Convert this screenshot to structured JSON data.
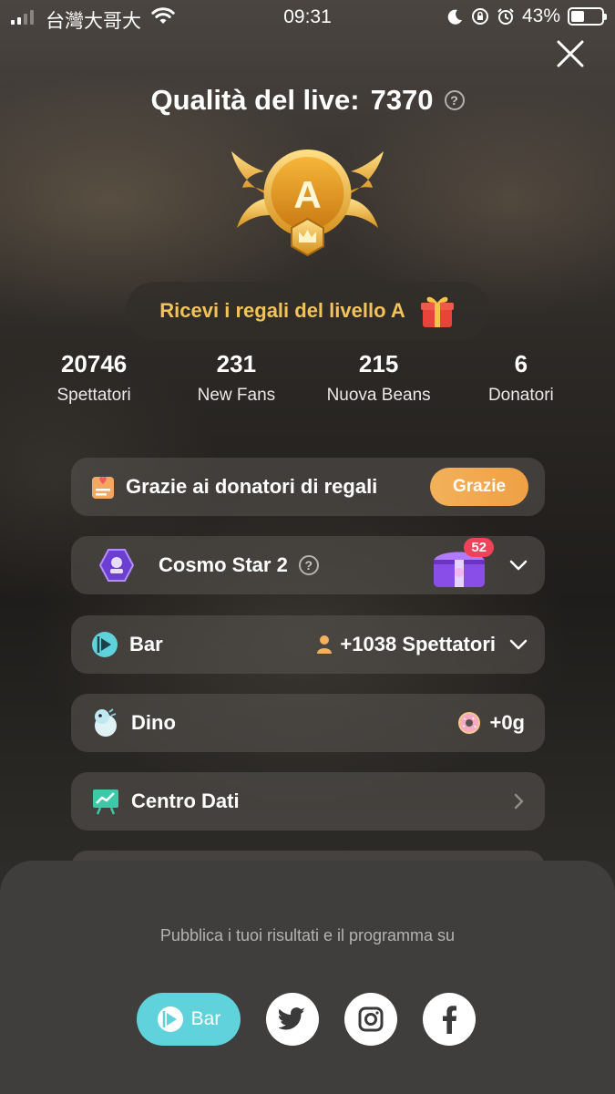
{
  "status_bar": {
    "carrier": "台灣大哥大",
    "time": "09:31",
    "battery": "43%",
    "battery_level": 0.43
  },
  "header": {
    "title_label": "Qualità del live:",
    "score": "7370",
    "help": "?"
  },
  "badge": {
    "grade": "A"
  },
  "reward": {
    "text": "Ricevi i regali del livello A"
  },
  "stats": [
    {
      "value": "20746",
      "label": "Spettatori"
    },
    {
      "value": "231",
      "label": "New Fans"
    },
    {
      "value": "215",
      "label": "Nuova Beans"
    },
    {
      "value": "6",
      "label": "Donatori"
    }
  ],
  "cards": {
    "thanks": {
      "title": "Grazie ai donatori di regali",
      "button": "Grazie"
    },
    "cosmo": {
      "title": "Cosmo Star 2",
      "help": "?",
      "chest_count": "52"
    },
    "bar": {
      "title": "Bar",
      "value": "+1038 Spettatori"
    },
    "dino": {
      "title": "Dino",
      "value": "+0g"
    },
    "data_center": {
      "title": "Centro Dati"
    }
  },
  "share_sheet": {
    "text": "Pubblica i tuoi risultati e il programma su",
    "bar_label": "Bar",
    "icons": [
      "twitter-icon",
      "instagram-icon",
      "facebook-icon"
    ]
  },
  "colors": {
    "accent_gold": "#f2c35a",
    "thanks_button": "#f0a045",
    "bar_share": "#5fd2dc",
    "chest_badge": "#f0435a"
  }
}
